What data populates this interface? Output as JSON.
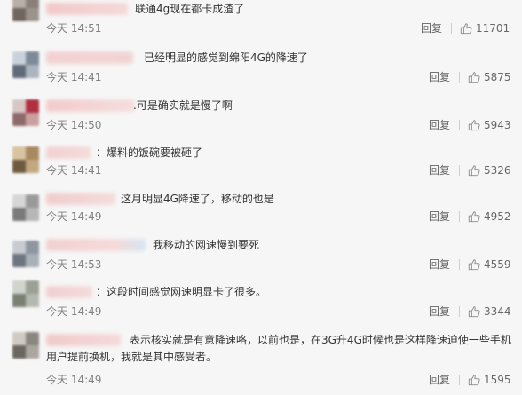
{
  "comments": [
    {
      "text": "联通4g现在都卡成渣了",
      "time": "今天 14:51",
      "reply": "回复",
      "likes": "11701"
    },
    {
      "text": "已经明显的感觉到绵阳4G的降速了",
      "time": "今天 14:41",
      "reply": "回复",
      "likes": "5875"
    },
    {
      "text": ".可是确实就是慢了啊",
      "time": "今天 14:50",
      "reply": "回复",
      "likes": "5943"
    },
    {
      "text": "：爆料的饭碗要被砸了",
      "time": "今天 14:41",
      "reply": "回复",
      "likes": "5326"
    },
    {
      "text": "这月明显4G降速了，移动的也是",
      "time": "今天 14:49",
      "reply": "回复",
      "likes": "4952"
    },
    {
      "text": "我移动的网速慢到要死",
      "time": "今天 14:53",
      "reply": "回复",
      "likes": "4559"
    },
    {
      "text": "：这段时间感觉网速明显卡了很多。",
      "time": "今天 14:49",
      "reply": "回复",
      "likes": "3344"
    },
    {
      "text_line1": "表示核实就是有意降速咯，以前也是，在3G升4G时候也是这样降速迫使一些手机",
      "text_line2": "用户提前换机，我就是其中感受者。",
      "time": "今天 14:49",
      "reply": "回复",
      "likes": "1595"
    }
  ],
  "colors": {
    "background": "#f6f6f6",
    "text": "#333333",
    "meta": "#808080"
  },
  "icons": {
    "like": "thumbs-up-icon"
  }
}
